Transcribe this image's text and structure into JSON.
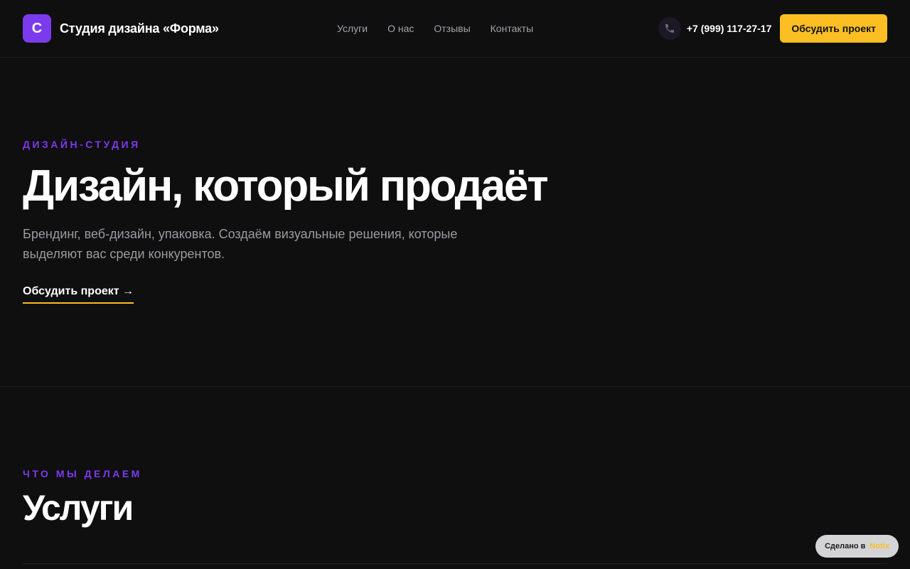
{
  "header": {
    "logo_letter": "С",
    "brand_name": "Студия дизайна «Форма»",
    "nav": [
      {
        "label": "Услуги"
      },
      {
        "label": "О нас"
      },
      {
        "label": "Отзывы"
      },
      {
        "label": "Контакты"
      }
    ],
    "phone_icon": "phone-icon",
    "phone": "+7 (999) 117-27-17",
    "cta_label": "Обсудить проект"
  },
  "hero": {
    "eyebrow": "Дизайн-студия",
    "title": "Дизайн, который продаёт",
    "description": "Брендинг, веб-дизайн, упаковка. Создаём визуальные решения, которые выделяют вас среди конкурентов.",
    "link_label": "Обсудить проект →"
  },
  "services": {
    "eyebrow": "Что мы делаем",
    "title": "Услуги"
  },
  "badge": {
    "prefix": "Сделано в",
    "brand": "Notix"
  },
  "colors": {
    "background": "#0f0f10",
    "accent_purple": "#7c3aed",
    "accent_yellow": "#fbbf24",
    "muted_text": "#9a9aa0"
  }
}
